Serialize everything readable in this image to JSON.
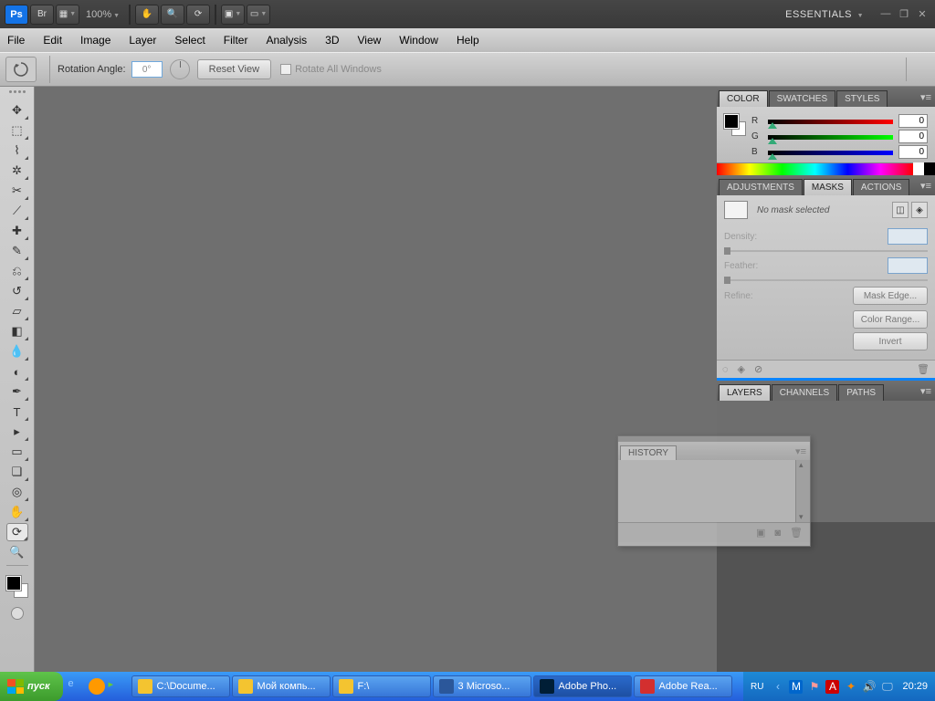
{
  "appbar": {
    "ps": "Ps",
    "br": "Br",
    "zoom": "100%",
    "workspace": "ESSENTIALS"
  },
  "menu": [
    "File",
    "Edit",
    "Image",
    "Layer",
    "Select",
    "Filter",
    "Analysis",
    "3D",
    "View",
    "Window",
    "Help"
  ],
  "options": {
    "rot_label": "Rotation Angle:",
    "rot_value": "0°",
    "reset": "Reset View",
    "rotate_all": "Rotate All Windows"
  },
  "panels": {
    "color": {
      "tabs": [
        "COLOR",
        "SWATCHES",
        "STYLES"
      ],
      "R": "0",
      "G": "0",
      "B": "0"
    },
    "masks": {
      "tabs": [
        "ADJUSTMENTS",
        "MASKS",
        "ACTIONS"
      ],
      "msg": "No mask selected",
      "density": "Density:",
      "feather": "Feather:",
      "refine": "Refine:",
      "btn_edge": "Mask Edge...",
      "btn_color": "Color Range...",
      "btn_invert": "Invert"
    },
    "layers": {
      "tabs": [
        "LAYERS",
        "CHANNELS",
        "PATHS"
      ]
    },
    "history": {
      "tab": "HISTORY"
    }
  },
  "taskbar": {
    "start": "пуск",
    "items": [
      {
        "label": "C:\\Docume...",
        "icon": "f"
      },
      {
        "label": "Мой компь...",
        "icon": "f"
      },
      {
        "label": "F:\\",
        "icon": "f"
      },
      {
        "label": "3 Microso...",
        "icon": "w"
      },
      {
        "label": "Adobe Pho...",
        "icon": "ps",
        "active": true
      },
      {
        "label": "Adobe Rea...",
        "icon": "pdf"
      }
    ],
    "lang": "RU",
    "clock": "20:29"
  }
}
